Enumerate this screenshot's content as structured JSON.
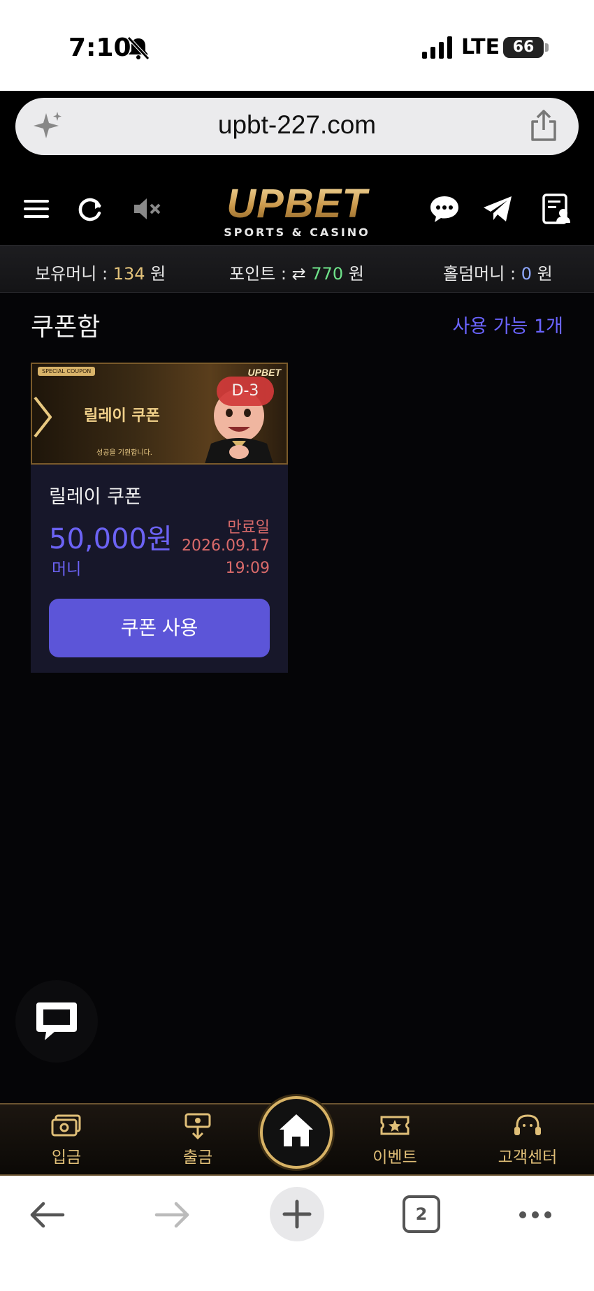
{
  "status": {
    "time": "7:10",
    "network": "LTE",
    "battery": "66"
  },
  "browser": {
    "url": "upbt-227.com",
    "tab_count": "2"
  },
  "header": {
    "logo_main": "UPBET",
    "logo_sub": "SPORTS & CASINO"
  },
  "balance": {
    "money_label": "보유머니 :",
    "money_value": "134",
    "money_unit": "원",
    "point_label": "포인트 :",
    "point_value": "770",
    "point_unit": "원",
    "holdem_label": "홀덤머니 :",
    "holdem_value": "0",
    "holdem_unit": "원"
  },
  "page": {
    "title": "쿠폰함",
    "available": "사용 가능 1개"
  },
  "coupon": {
    "banner_tag": "SPECIAL COUPON",
    "banner_title": "릴레이 쿠폰",
    "banner_sub": "성공을 기원합니다.",
    "banner_logo": "UPBET",
    "dday": "D-3",
    "name": "릴레이 쿠폰",
    "amount": "50,000원",
    "type": "머니",
    "expiry_label": "만료일",
    "expiry_date": "2026.09.17",
    "expiry_time": "19:09",
    "use_button": "쿠폰 사용"
  },
  "nav": {
    "deposit": "입금",
    "withdraw": "출금",
    "event": "이벤트",
    "support": "고객센터"
  },
  "colors": {
    "accent": "#5c55d8",
    "gold": "#e0bf78",
    "expiry": "#d96a6a"
  }
}
